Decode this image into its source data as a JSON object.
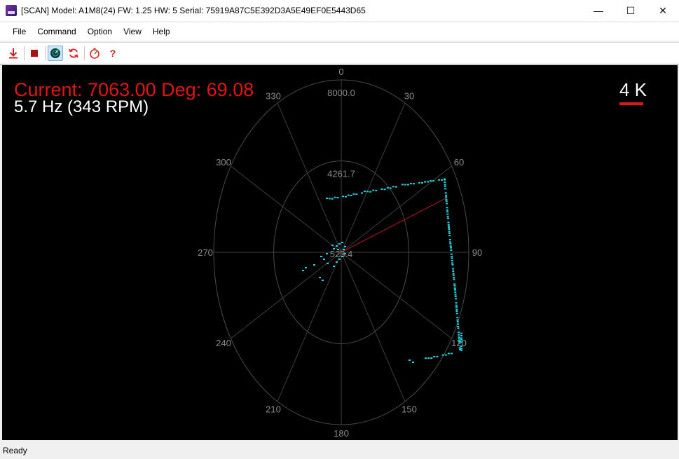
{
  "window": {
    "title": "[SCAN] Model: A1M8(24) FW: 1.25 HW: 5 Serial: 75919A87C5E392D3A5E49EF0E5443D65",
    "minimize": "—",
    "maximize": "☐",
    "close": "✕"
  },
  "menu": [
    "File",
    "Command",
    "Option",
    "View",
    "Help"
  ],
  "toolbar": {
    "buttons": [
      {
        "icon": "download-icon",
        "color": "#cc2222"
      },
      {
        "icon": "stop-icon",
        "color": "#aa1111"
      },
      {
        "icon": "scan-radar-icon",
        "color": "#0a3a3a"
      },
      {
        "icon": "refresh-icon",
        "color": "#d22"
      },
      {
        "icon": "timer-icon",
        "color": "#d22"
      },
      {
        "icon": "help-icon",
        "color": "#cc2222"
      }
    ],
    "help_glyph": "?"
  },
  "scan": {
    "current_text": "Current: 7063.00 Deg: 69.08",
    "rate_text": "5.7 Hz (343 RPM)",
    "scale_text": "4 K",
    "angle_labels": [
      "0",
      "30",
      "60",
      "90",
      "120",
      "150",
      "180",
      "210",
      "240",
      "270",
      "300",
      "330"
    ],
    "ring_labels": [
      "8000.0",
      "4261.7",
      "523.4"
    ],
    "point_color": "#22d3e0",
    "beam_color": "#b01c1c",
    "beam": {
      "deg": 69.08,
      "dist": 7063
    }
  },
  "status": {
    "text": "Ready"
  }
}
